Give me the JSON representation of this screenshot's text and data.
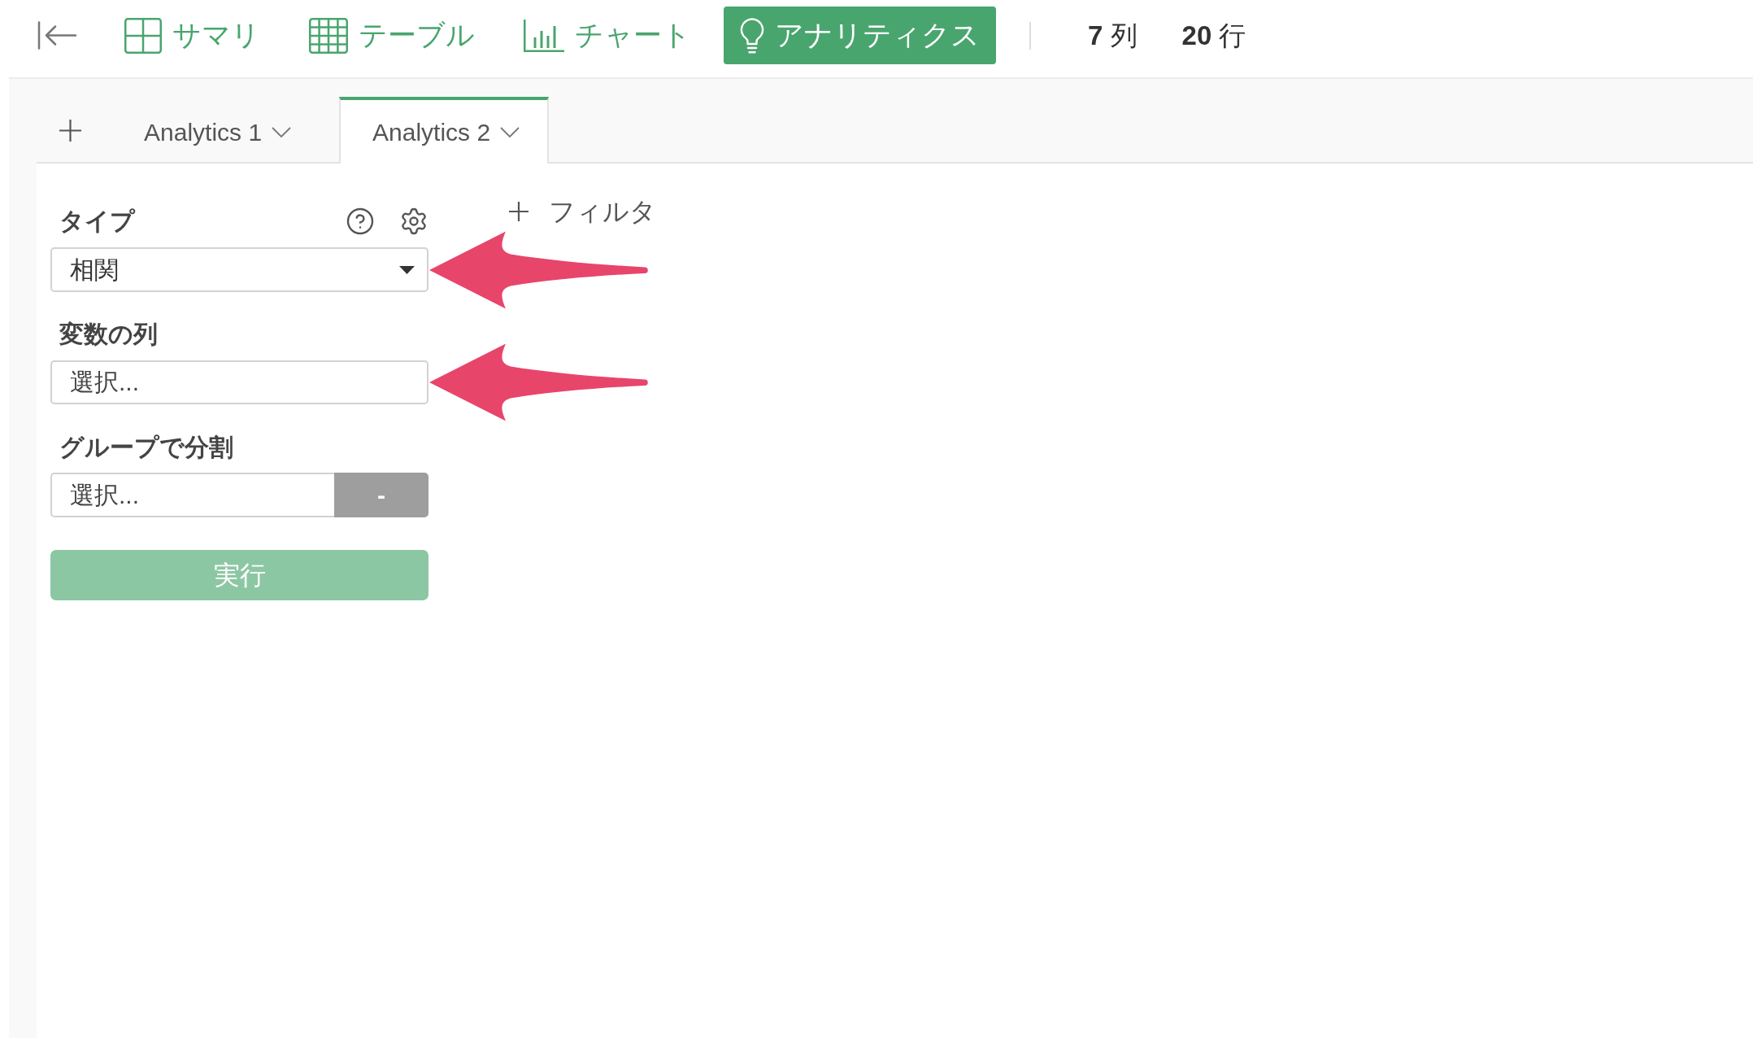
{
  "toolbar": {
    "views": [
      {
        "kind": "summary",
        "label": "サマリ",
        "selected": false
      },
      {
        "kind": "table",
        "label": "テーブル",
        "selected": false
      },
      {
        "kind": "chart",
        "label": "チャート",
        "selected": false
      },
      {
        "kind": "analytics",
        "label": "アナリティクス",
        "selected": true
      }
    ],
    "counts": [
      "**7** 列",
      "**20** 行"
    ]
  },
  "tabs": [
    {
      "label": "Analytics 1",
      "selected": false
    },
    {
      "label": "Analytics 2",
      "selected": true
    }
  ],
  "settings_panel": {
    "type": {
      "label": "タイプ",
      "value": "相関",
      "callout": true
    },
    "variable_columns": {
      "label": "変数の列",
      "placeholder": "選択...",
      "callout": true
    },
    "group_by": {
      "label": "グループで分割",
      "placeholder": "選択...",
      "button": "-"
    },
    "run_button": {
      "label": "実行",
      "disabled": true
    }
  },
  "filter_button": {
    "label": "フィルタ"
  }
}
